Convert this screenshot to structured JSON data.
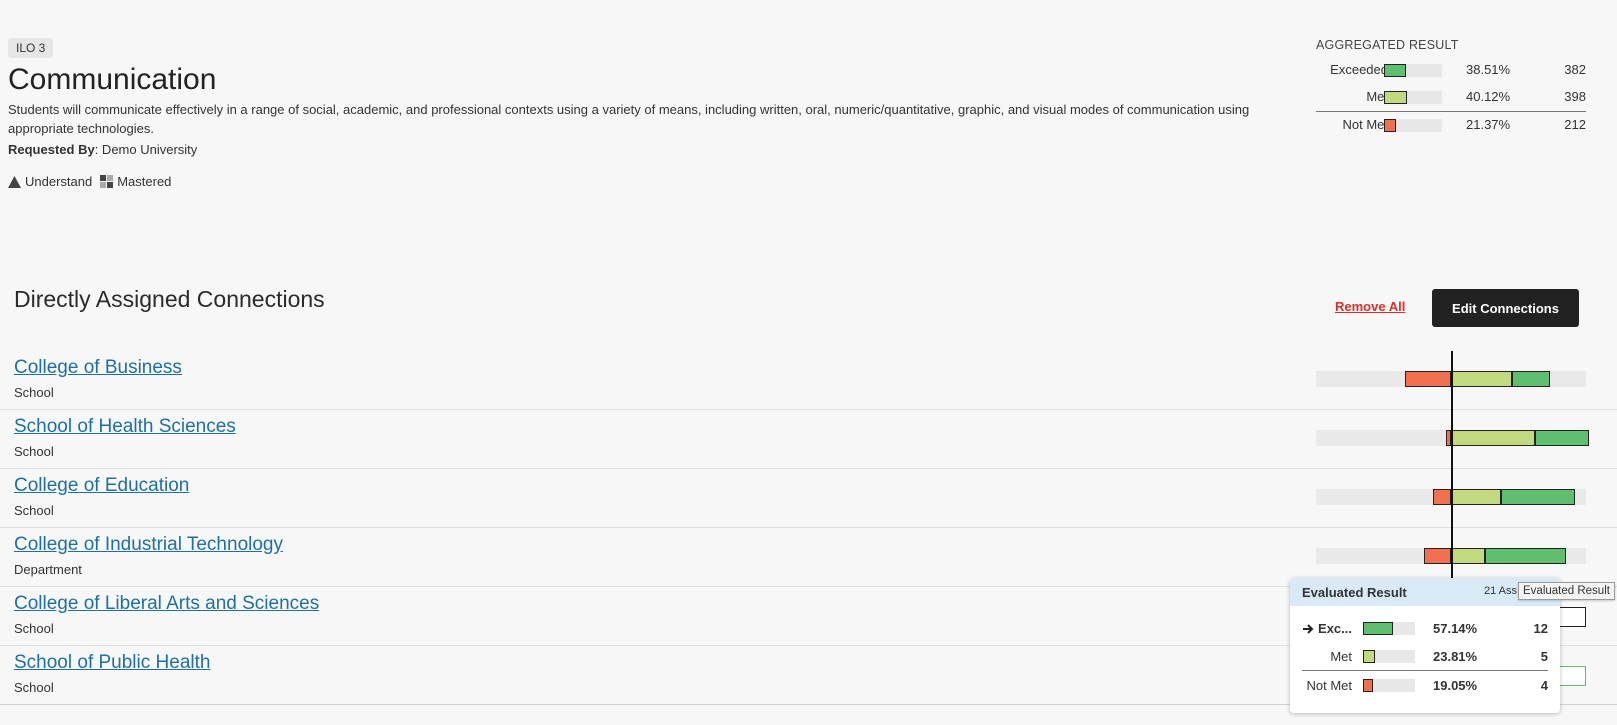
{
  "outcome": {
    "badge": "ILO 3",
    "title": "Communication",
    "description": "Students will communicate effectively in a range of social, academic, and professional contexts using a variety of means, including written, oral, numeric/quantitative, graphic, and visual modes of communication using appropriate technologies.",
    "requested_by_label": "Requested By",
    "requested_by_value": ": Demo University",
    "legend": [
      {
        "icon": "understand-icon",
        "label": "Understand"
      },
      {
        "icon": "mastered-icon",
        "label": "Mastered"
      }
    ]
  },
  "aggregated": {
    "title": "AGGREGATED RESULT",
    "rows": [
      {
        "label": "Exceeded",
        "percent": "38.51%",
        "count": "382",
        "fraction": 0.3851,
        "color": "#5fbf6e"
      },
      {
        "label": "Met",
        "percent": "40.12%",
        "count": "398",
        "fraction": 0.4012,
        "color": "#c3d980"
      },
      {
        "label": "Not Met",
        "percent": "21.37%",
        "count": "212",
        "fraction": 0.2137,
        "color": "#f07050"
      }
    ]
  },
  "connections_section": {
    "title": "Directly Assigned Connections",
    "remove_all_label": "Remove All",
    "edit_label": "Edit Connections"
  },
  "connections": [
    {
      "name": "College of Business",
      "type": "School",
      "not_met": 0.34,
      "met": 0.455,
      "exceeded": 0.285
    },
    {
      "name": "School of Health Sciences",
      "type": "School",
      "not_met": 0.035,
      "met": 0.62,
      "exceeded": 0.4
    },
    {
      "name": "College of Education",
      "type": "School",
      "not_met": 0.135,
      "met": 0.37,
      "exceeded": 0.55
    },
    {
      "name": "College of Industrial Technology",
      "type": "Department",
      "not_met": 0.2,
      "met": 0.25,
      "exceeded": 0.6
    },
    {
      "name": "College of Liberal Arts and Sciences",
      "type": "School"
    },
    {
      "name": "School of Public Health",
      "type": "School"
    }
  ],
  "popup": {
    "title": "Evaluated Result",
    "assessments": "21 Ass",
    "rows": [
      {
        "label": "Exc...",
        "percent": "57.14%",
        "count": "12",
        "fraction": 0.5714,
        "color": "#5fbf6e",
        "current": true
      },
      {
        "label": "Met",
        "percent": "23.81%",
        "count": "5",
        "fraction": 0.2381,
        "color": "#c3d980"
      },
      {
        "label": "Not Met",
        "percent": "19.05%",
        "count": "4",
        "fraction": 0.1905,
        "color": "#f07050"
      }
    ]
  },
  "tooltip": "Evaluated Result",
  "colors": {
    "link": "#1f6fa5",
    "danger": "#d8312b",
    "exceeded": "#5fbf6e",
    "met": "#c3d980",
    "not_met": "#f07050"
  }
}
